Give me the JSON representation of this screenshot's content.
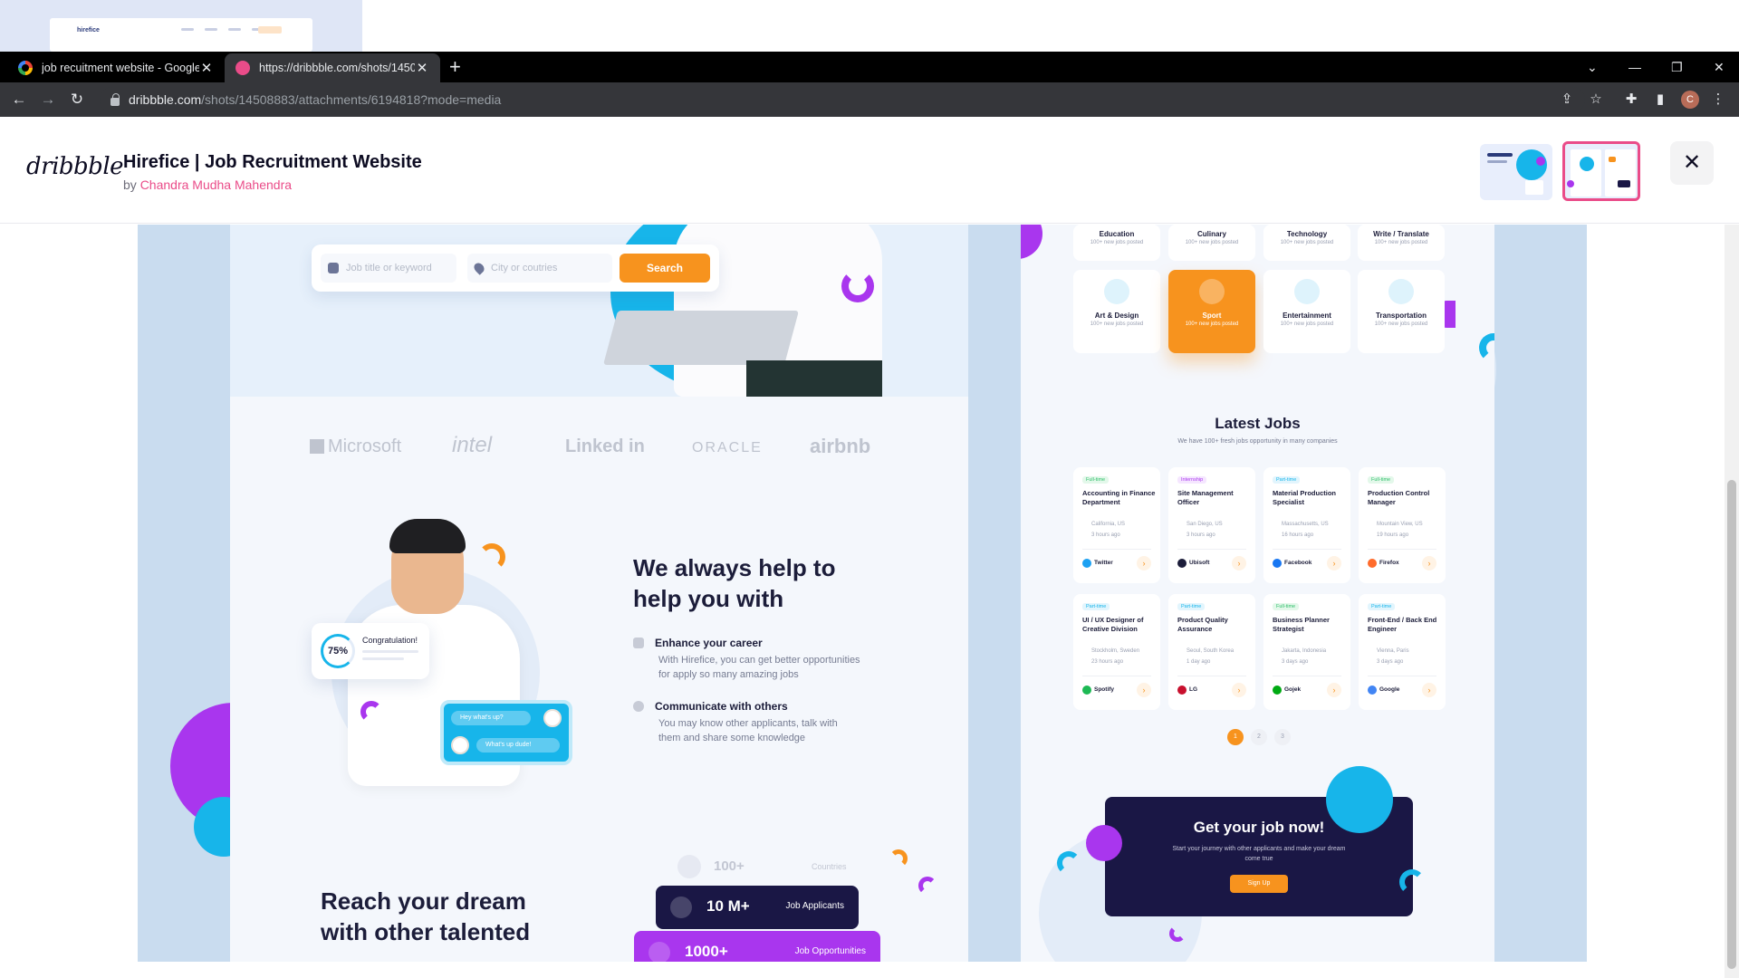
{
  "browser": {
    "tabs": [
      {
        "title": "job recuitment website - Google",
        "active": false
      },
      {
        "title": "https://dribbble.com/shots/1450",
        "active": true
      }
    ],
    "url_host": "dribbble.com",
    "url_rest": "/shots/14508883/attachments/6194818?mode=media",
    "profile_initial": "C"
  },
  "shot": {
    "logo": "dribbble",
    "title": "Hirefice | Job Recruitment Website",
    "by_label": "by",
    "author": "Chandra Mudha Mahendra"
  },
  "strip": {
    "logo": "hirefice"
  },
  "mock_left": {
    "search": {
      "job_placeholder": "Job title or keyword",
      "city_placeholder": "City or coutries",
      "button": "Search"
    },
    "brands": [
      "Microsoft",
      "intel",
      "Linked in",
      "ORACLE",
      "airbnb"
    ],
    "congrats": {
      "percent": "75%",
      "label": "Congratulation!"
    },
    "chat": {
      "msg1": "Hey what's up?",
      "msg2": "What's up dude!"
    },
    "help_title_1": "We always help to",
    "help_title_2": "help you with",
    "features": [
      {
        "title": "Enhance your career",
        "desc1": "With Hirefice, you can get better opportunities",
        "desc2": "for apply so many amazing jobs"
      },
      {
        "title": "Communicate with others",
        "desc1": "You may know other applicants, talk with",
        "desc2": "them and share some knowledge"
      }
    ],
    "stats": {
      "countries_value": "100+",
      "countries_label": "Countries",
      "applicants_value": "10 M+",
      "applicants_label": "Job Applicants",
      "opportunities_value": "1000+",
      "opportunities_label": "Job Opportunities"
    },
    "reach_1": "Reach your dream",
    "reach_2": "with other talented"
  },
  "mock_right": {
    "categories_top": [
      {
        "name": "Education",
        "sub": "100+ new jobs posted"
      },
      {
        "name": "Culinary",
        "sub": "100+ new jobs posted"
      },
      {
        "name": "Technology",
        "sub": "100+ new jobs posted"
      },
      {
        "name": "Write / Translate",
        "sub": "100+ new jobs posted"
      }
    ],
    "categories": [
      {
        "name": "Art & Design",
        "sub": "100+ new jobs posted"
      },
      {
        "name": "Sport",
        "sub": "100+ new jobs posted"
      },
      {
        "name": "Entertainment",
        "sub": "100+ new jobs posted"
      },
      {
        "name": "Transportation",
        "sub": "100+ new jobs posted"
      }
    ],
    "latest_title": "Latest Jobs",
    "latest_sub": "We have 100+ fresh jobs opportunity in many companies",
    "jobs": [
      {
        "tag": "Full-time",
        "title": "Accounting in Finance Department",
        "loc": "California, US",
        "time": "3 hours ago",
        "company": "Twitter"
      },
      {
        "tag": "Internship",
        "title": "Site Management Officer",
        "loc": "San Diego, US",
        "time": "3 hours ago",
        "company": "Ubisoft"
      },
      {
        "tag": "Part-time",
        "title": "Material Production Specialist",
        "loc": "Massachusetts, US",
        "time": "16 hours ago",
        "company": "Facebook"
      },
      {
        "tag": "Full-time",
        "title": "Production Control Manager",
        "loc": "Mountain View, US",
        "time": "19 hours ago",
        "company": "Firefox"
      },
      {
        "tag": "Part-time",
        "title": "UI / UX Designer of Creative Division",
        "loc": "Stockholm, Sweden",
        "time": "23 hours ago",
        "company": "Spotify"
      },
      {
        "tag": "Part-time",
        "title": "Product Quality Assurance",
        "loc": "Seoul, South Korea",
        "time": "1 day ago",
        "company": "LG"
      },
      {
        "tag": "Full-time",
        "title": "Business Planner Strategist",
        "loc": "Jakarta, Indonesia",
        "time": "3 days ago",
        "company": "Gojek"
      },
      {
        "tag": "Part-time",
        "title": "Front-End / Back End Engineer",
        "loc": "Vienna, Paris",
        "time": "3 days ago",
        "company": "Google"
      }
    ],
    "pages": [
      "1",
      "2",
      "3"
    ],
    "cta": {
      "title": "Get your job now!",
      "desc": "Start your journey with other applicants and make your dream come true",
      "button": "Sign Up"
    }
  },
  "colors": {
    "accent": "#f7931e",
    "brand_pink": "#ea4c89",
    "navy": "#1a1745",
    "cyan": "#17b5ea",
    "purple": "#a936ee"
  }
}
